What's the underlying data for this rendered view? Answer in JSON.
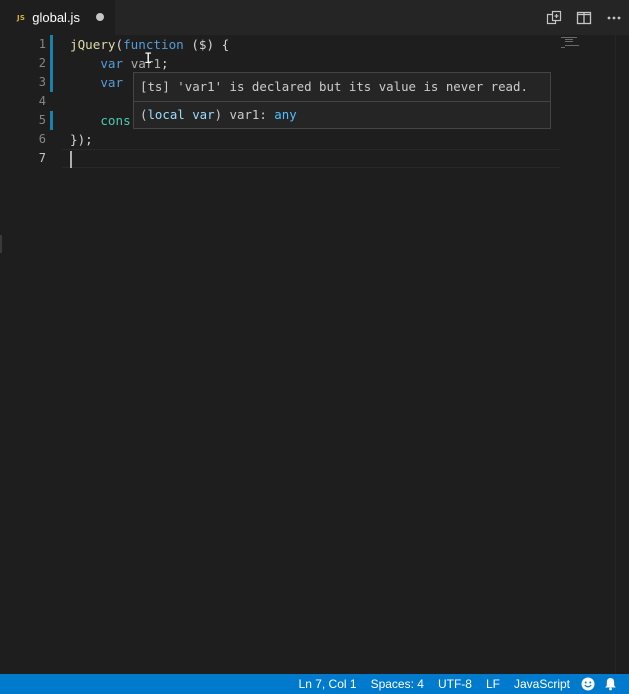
{
  "tab": {
    "icon_label": "JS",
    "file_name": "global.js",
    "dirty": true
  },
  "toolbar": {
    "icons": [
      "open-changes-icon",
      "split-editor-icon",
      "more-actions-icon"
    ],
    "more_label": "···"
  },
  "editor": {
    "line_numbers": [
      "1",
      "2",
      "3",
      "4",
      "5",
      "6",
      "7"
    ],
    "active_line": 7,
    "modified_lines": [
      1,
      2,
      3,
      5
    ],
    "lines": [
      {
        "number": "1",
        "tokens": [
          {
            "text": "jQuery",
            "kind": "function"
          },
          {
            "text": "(",
            "kind": "plain"
          },
          {
            "text": "function",
            "kind": "keyword"
          },
          {
            "text": " ($) {",
            "kind": "plain"
          }
        ]
      },
      {
        "number": "2",
        "tokens": [
          {
            "text": "    ",
            "kind": "plain"
          },
          {
            "text": "var",
            "kind": "keyword"
          },
          {
            "text": " ",
            "kind": "plain"
          },
          {
            "text": "var1",
            "kind": "unused"
          },
          {
            "text": ";",
            "kind": "plain"
          }
        ]
      },
      {
        "number": "3",
        "tokens": [
          {
            "text": "    ",
            "kind": "plain"
          },
          {
            "text": "var",
            "kind": "keyword"
          }
        ]
      },
      {
        "number": "4",
        "tokens": []
      },
      {
        "number": "5",
        "tokens": [
          {
            "text": "    ",
            "kind": "plain"
          },
          {
            "text": "cons",
            "kind": "const"
          }
        ]
      },
      {
        "number": "6",
        "tokens": [
          {
            "text": "});",
            "kind": "plain"
          }
        ]
      },
      {
        "number": "7",
        "tokens": []
      }
    ]
  },
  "hover": {
    "message": "[ts] 'var1' is declared but its value is never read.",
    "signature_open": "(",
    "signature_kind": "local var",
    "signature_mid": ") var1: ",
    "signature_type": "any"
  },
  "statusbar": {
    "position": "Ln 7, Col 1",
    "indentation": "Spaces: 4",
    "encoding": "UTF-8",
    "line_ending": "LF",
    "language": "JavaScript",
    "icons": [
      "feedback-smiley-icon",
      "notifications-bell-icon"
    ]
  },
  "colors": {
    "editor_background": "#1e1e1e",
    "statusbar_background": "#007acc",
    "keyword": "#569cd6",
    "function": "#dcdcaa",
    "variable": "#9cdcfe",
    "git_modified": "#1b81a8"
  }
}
